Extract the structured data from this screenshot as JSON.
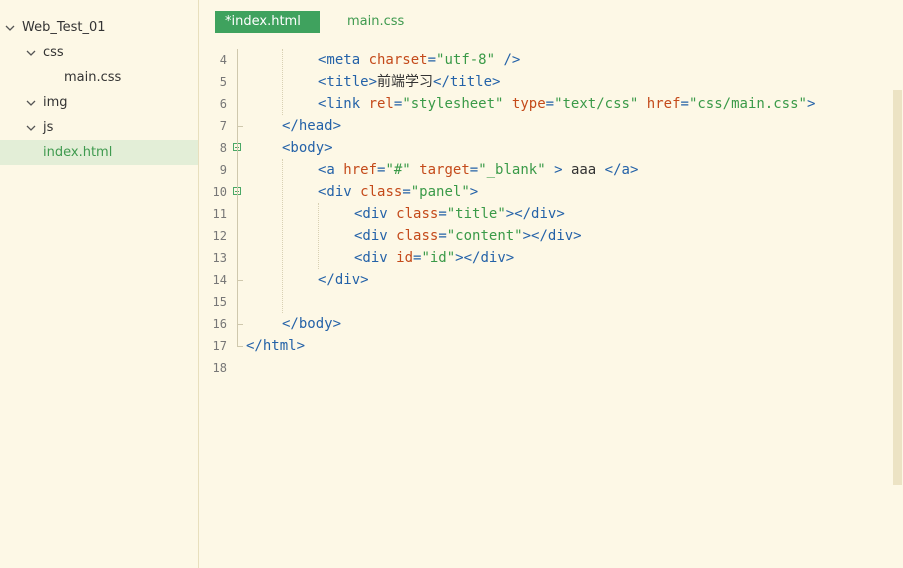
{
  "sidebar": {
    "items": [
      {
        "label": "Web_Test_01",
        "expanded": true
      },
      {
        "label": "css",
        "expanded": true
      },
      {
        "label": "main.css"
      },
      {
        "label": "img",
        "expanded": true
      },
      {
        "label": "js",
        "expanded": true
      },
      {
        "label": "index.html",
        "selected": true
      }
    ]
  },
  "tabs": [
    {
      "label": "*index.html",
      "active": true
    },
    {
      "label": "main.css",
      "active": false
    }
  ],
  "editor": {
    "lines": [
      {
        "num": "4",
        "indent": 2,
        "tokens": [
          [
            "tag",
            "<meta "
          ],
          [
            "attr",
            "charset"
          ],
          [
            "tag",
            "="
          ],
          [
            "str",
            "\"utf-8\""
          ],
          [
            "tag",
            " />"
          ]
        ]
      },
      {
        "num": "5",
        "indent": 2,
        "tokens": [
          [
            "tag",
            "<title>"
          ],
          [
            "txt",
            "前端学习"
          ],
          [
            "tag",
            "</title>"
          ]
        ]
      },
      {
        "num": "6",
        "indent": 2,
        "tokens": [
          [
            "tag",
            "<link "
          ],
          [
            "attr",
            "rel"
          ],
          [
            "tag",
            "="
          ],
          [
            "str",
            "\"stylesheet\""
          ],
          [
            "tag",
            " "
          ],
          [
            "attr",
            "type"
          ],
          [
            "tag",
            "="
          ],
          [
            "str",
            "\"text/css\""
          ],
          [
            "tag",
            " "
          ],
          [
            "attr",
            "href"
          ],
          [
            "tag",
            "="
          ],
          [
            "str",
            "\"css/main.css\""
          ],
          [
            "tag",
            ">"
          ]
        ]
      },
      {
        "num": "7",
        "indent": 1,
        "tokens": [
          [
            "tag",
            "</head>"
          ]
        ]
      },
      {
        "num": "8",
        "indent": 1,
        "fold": true,
        "tokens": [
          [
            "tag",
            "<body>"
          ]
        ]
      },
      {
        "num": "9",
        "indent": 2,
        "tokens": [
          [
            "tag",
            "<a "
          ],
          [
            "attr",
            "href"
          ],
          [
            "tag",
            "="
          ],
          [
            "str",
            "\"#\""
          ],
          [
            "tag",
            " "
          ],
          [
            "attr",
            "target"
          ],
          [
            "tag",
            "="
          ],
          [
            "str",
            "\"_blank\""
          ],
          [
            "tag",
            " > "
          ],
          [
            "txt",
            "aaa "
          ],
          [
            "tag",
            "</a>"
          ]
        ]
      },
      {
        "num": "10",
        "indent": 2,
        "fold": true,
        "tokens": [
          [
            "tag",
            "<div "
          ],
          [
            "attr",
            "class"
          ],
          [
            "tag",
            "="
          ],
          [
            "str",
            "\"panel\""
          ],
          [
            "tag",
            ">"
          ]
        ]
      },
      {
        "num": "11",
        "indent": 3,
        "tokens": [
          [
            "tag",
            "<div "
          ],
          [
            "attr",
            "class"
          ],
          [
            "tag",
            "="
          ],
          [
            "str",
            "\"title\""
          ],
          [
            "tag",
            "></div>"
          ]
        ]
      },
      {
        "num": "12",
        "indent": 3,
        "tokens": [
          [
            "tag",
            "<div "
          ],
          [
            "attr",
            "class"
          ],
          [
            "tag",
            "="
          ],
          [
            "str",
            "\"content\""
          ],
          [
            "tag",
            "></div>"
          ]
        ]
      },
      {
        "num": "13",
        "indent": 3,
        "tokens": [
          [
            "tag",
            "<div "
          ],
          [
            "attr",
            "id"
          ],
          [
            "tag",
            "="
          ],
          [
            "str",
            "\"id\""
          ],
          [
            "tag",
            "></div>"
          ]
        ]
      },
      {
        "num": "14",
        "indent": 2,
        "tokens": [
          [
            "tag",
            "</div>"
          ]
        ]
      },
      {
        "num": "15",
        "indent": 0,
        "tokens": []
      },
      {
        "num": "16",
        "indent": 1,
        "tokens": [
          [
            "tag",
            "</body>"
          ]
        ]
      },
      {
        "num": "17",
        "indent": 0,
        "tokens": [
          [
            "tag",
            "</html>"
          ]
        ]
      },
      {
        "num": "18",
        "indent": 0,
        "tokens": []
      }
    ]
  },
  "colors": {
    "background": "#fdf8e6",
    "accent_green": "#3fa25e",
    "tag": "#2462a8",
    "attribute": "#c44a1a",
    "string": "#3a9a48"
  }
}
